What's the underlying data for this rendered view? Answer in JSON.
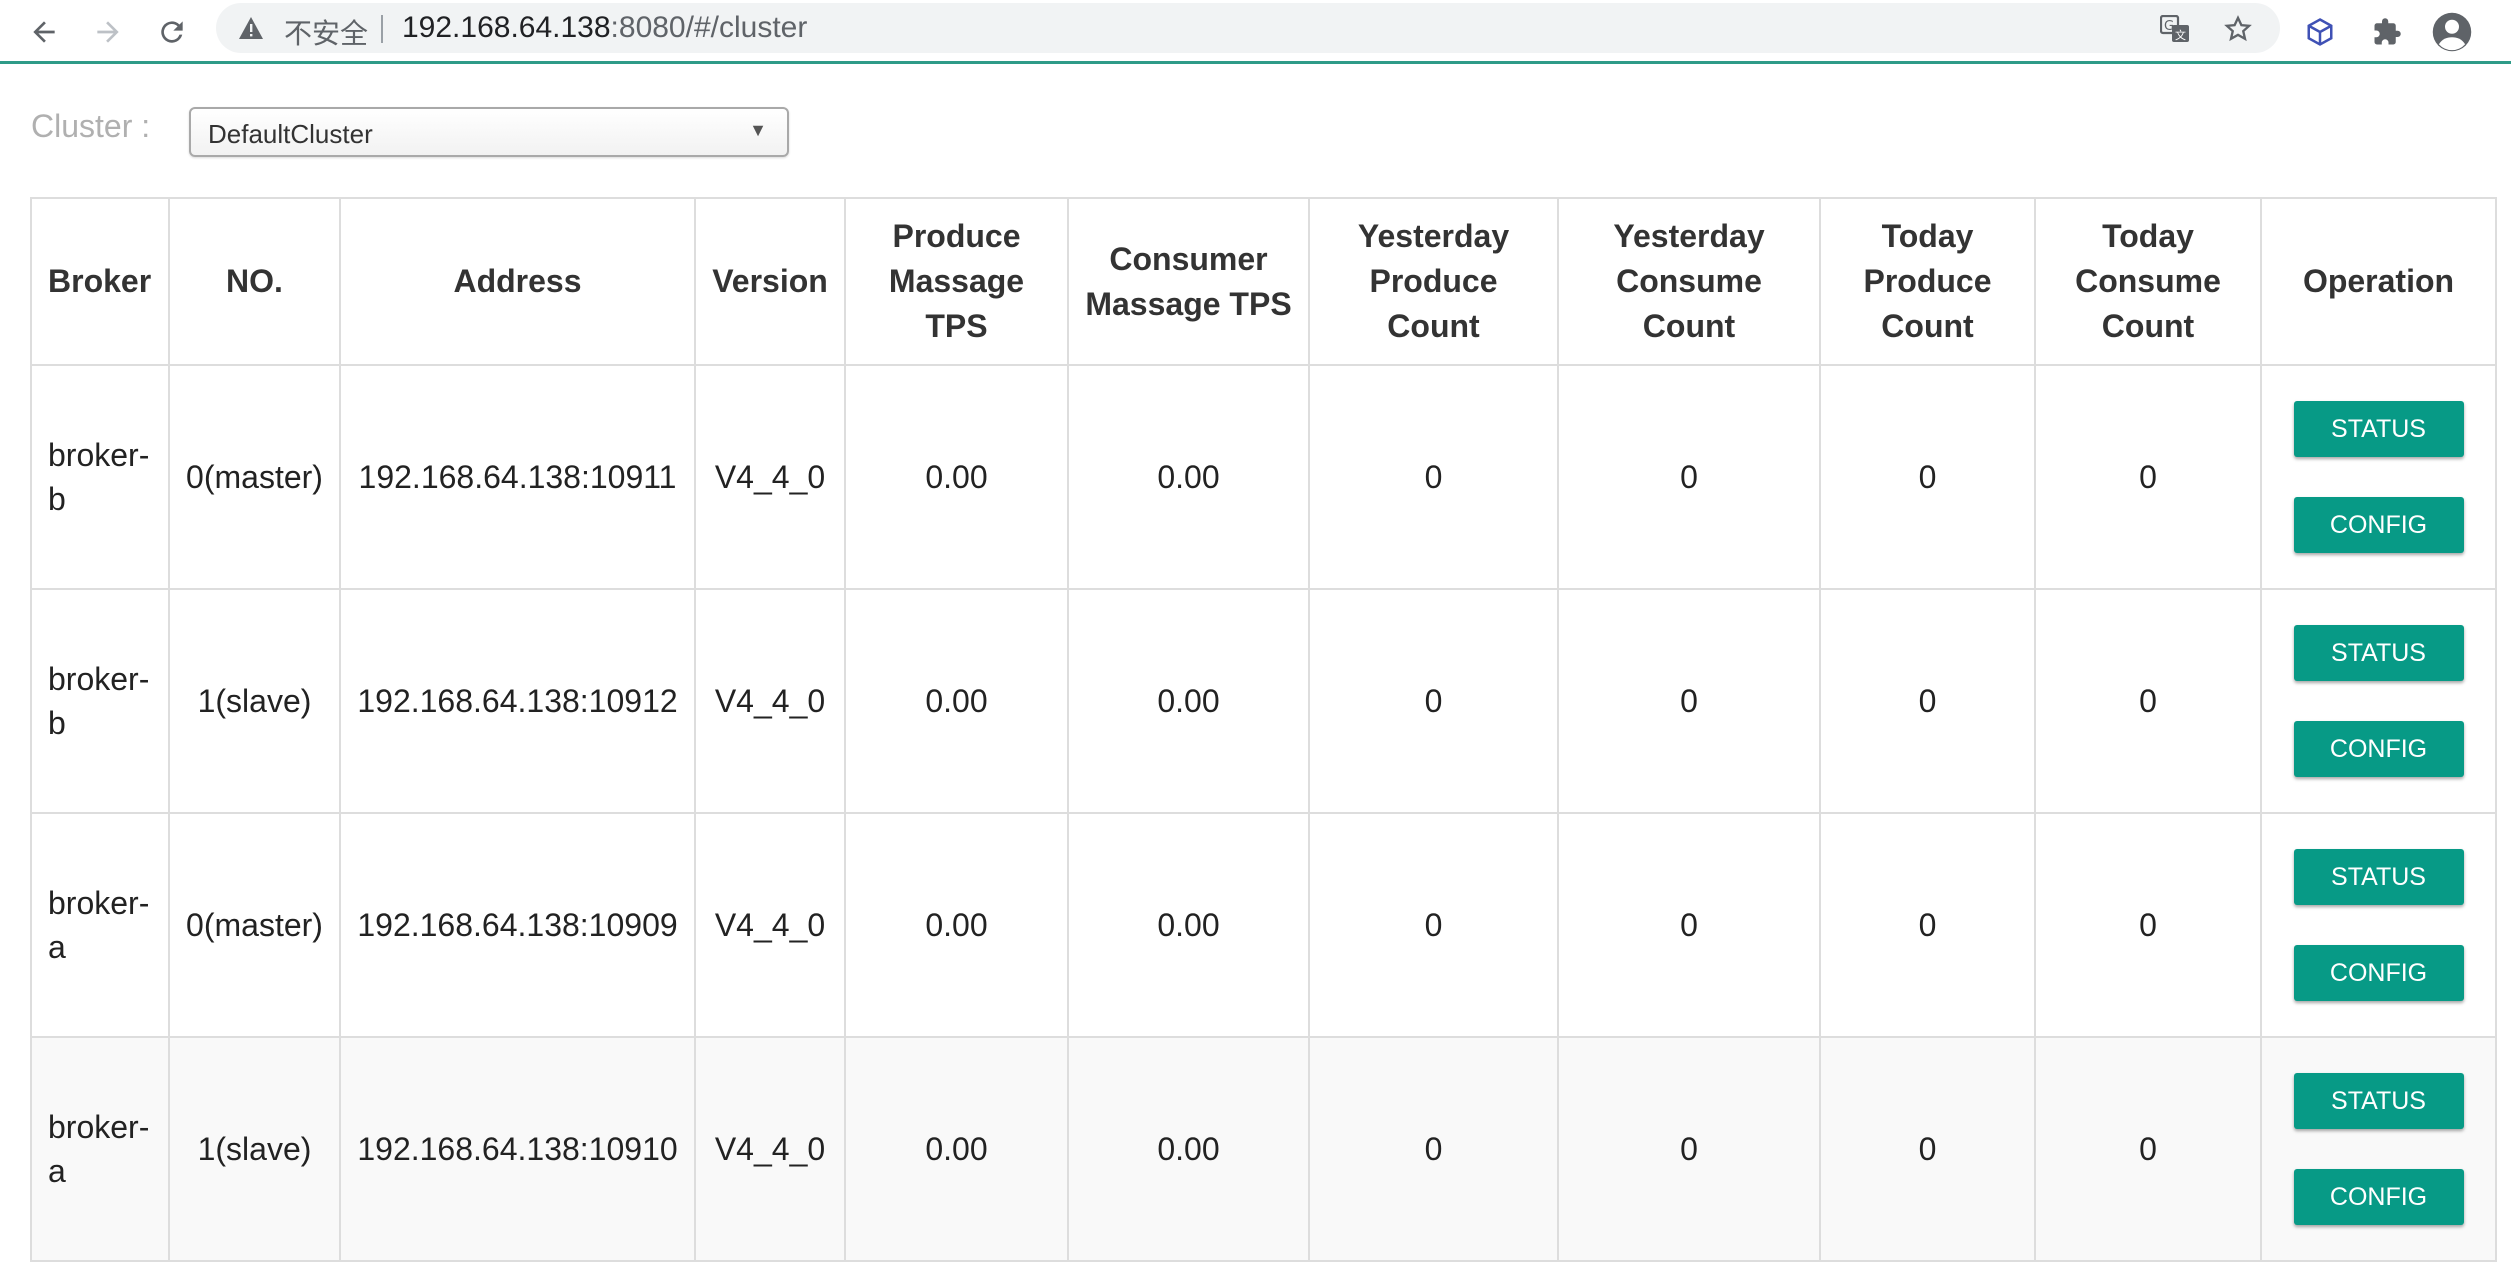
{
  "browser": {
    "security_label": "不安全",
    "url_host": "192.168.64.138",
    "url_path": ":8080/#/cluster"
  },
  "cluster": {
    "label": "Cluster :",
    "selected": "DefaultCluster"
  },
  "table": {
    "headers": {
      "broker": "Broker",
      "no": "NO.",
      "address": "Address",
      "version": "Version",
      "produce_tps": "Produce Massage TPS",
      "consumer_tps": "Consumer Massage TPS",
      "yesterday_produce": "Yesterday Produce Count",
      "yesterday_consume": "Yesterday Consume Count",
      "today_produce": "Today Produce Count",
      "today_consume": "Today Consume Count",
      "operation": "Operation"
    },
    "rows": [
      {
        "broker": "broker-b",
        "no": "0(master)",
        "address": "192.168.64.138:10911",
        "version": "V4_4_0",
        "produce_tps": "0.00",
        "consumer_tps": "0.00",
        "yesterday_produce": "0",
        "yesterday_consume": "0",
        "today_produce": "0",
        "today_consume": "0"
      },
      {
        "broker": "broker-b",
        "no": "1(slave)",
        "address": "192.168.64.138:10912",
        "version": "V4_4_0",
        "produce_tps": "0.00",
        "consumer_tps": "0.00",
        "yesterday_produce": "0",
        "yesterday_consume": "0",
        "today_produce": "0",
        "today_consume": "0"
      },
      {
        "broker": "broker-a",
        "no": "0(master)",
        "address": "192.168.64.138:10909",
        "version": "V4_4_0",
        "produce_tps": "0.00",
        "consumer_tps": "0.00",
        "yesterday_produce": "0",
        "yesterday_consume": "0",
        "today_produce": "0",
        "today_consume": "0"
      },
      {
        "broker": "broker-a",
        "no": "1(slave)",
        "address": "192.168.64.138:10910",
        "version": "V4_4_0",
        "produce_tps": "0.00",
        "consumer_tps": "0.00",
        "yesterday_produce": "0",
        "yesterday_consume": "0",
        "today_produce": "0",
        "today_consume": "0"
      }
    ],
    "buttons": {
      "status": "STATUS",
      "config": "CONFIG"
    }
  },
  "colors": {
    "accent": "#079a86",
    "toolbar_underline": "#2e9b88"
  },
  "icons": [
    "back-icon",
    "forward-icon",
    "reload-icon",
    "warning-icon",
    "translate-icon",
    "star-icon",
    "extension-cube-icon",
    "puzzle-icon",
    "profile-icon"
  ]
}
